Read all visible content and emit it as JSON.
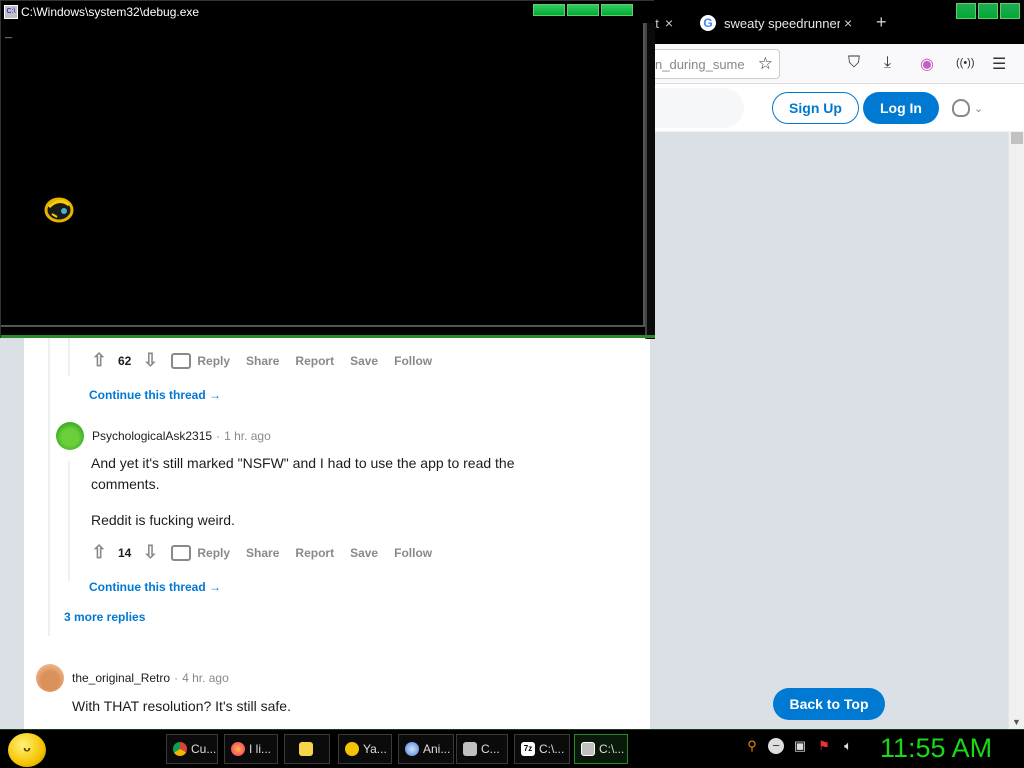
{
  "browser": {
    "tabs": [
      {
        "label": "at",
        "close": "×"
      },
      {
        "label": "sweaty speedrunner g",
        "close": "×"
      }
    ],
    "new_tab": "+",
    "url_text": "n_during_sume",
    "toolbar_icons": [
      "star-icon",
      "pocket-icon",
      "download-icon",
      "extension-icon",
      "settings-icon",
      "menu-icon"
    ]
  },
  "reddit_header": {
    "signup": "Sign Up",
    "login": "Log In"
  },
  "comments": {
    "first_actions": {
      "score": "62",
      "reply": "Reply",
      "share": "Share",
      "report": "Report",
      "save": "Save",
      "follow": "Follow"
    },
    "continue_1": "Continue this thread",
    "comment_2": {
      "user": "PsychologicalAsk2315",
      "time": "1 hr. ago",
      "para1": "And yet it's still marked \"NSFW\" and I had to use the app to read the comments.",
      "para2": "Reddit is fucking weird.",
      "score": "14",
      "reply": "Reply",
      "share": "Share",
      "report": "Report",
      "save": "Save",
      "follow": "Follow"
    },
    "continue_2": "Continue this thread",
    "more_replies": "3 more replies",
    "comment_3": {
      "user": "the_original_Retro",
      "time": "4 hr. ago",
      "body": "With THAT resolution? It's still safe."
    }
  },
  "back_to_top": "Back to Top",
  "console": {
    "title": "C:\\Windows\\system32\\debug.exe",
    "cursor": "_"
  },
  "taskbar": {
    "items": [
      {
        "label": "Cu...",
        "icon": "chrome-icon",
        "color": "#db4437"
      },
      {
        "label": "I li...",
        "icon": "firefox-icon",
        "color": "#ff7139"
      },
      {
        "label": "",
        "icon": "folder-icon",
        "color": "#f6d54a"
      },
      {
        "label": "Ya...",
        "icon": "smiley-icon",
        "color": "#f5c400"
      },
      {
        "label": "Ani...",
        "icon": "globe-icon",
        "color": "#4a7fd6"
      },
      {
        "label": "C...",
        "icon": "paint-icon",
        "color": "#c0c0c0"
      },
      {
        "label": "C:\\...",
        "icon": "7zip-icon",
        "color": "#ffffff"
      },
      {
        "label": "C:\\...",
        "icon": "console-icon",
        "color": "#c0c0c0"
      }
    ],
    "clock": "11:55 AM"
  }
}
